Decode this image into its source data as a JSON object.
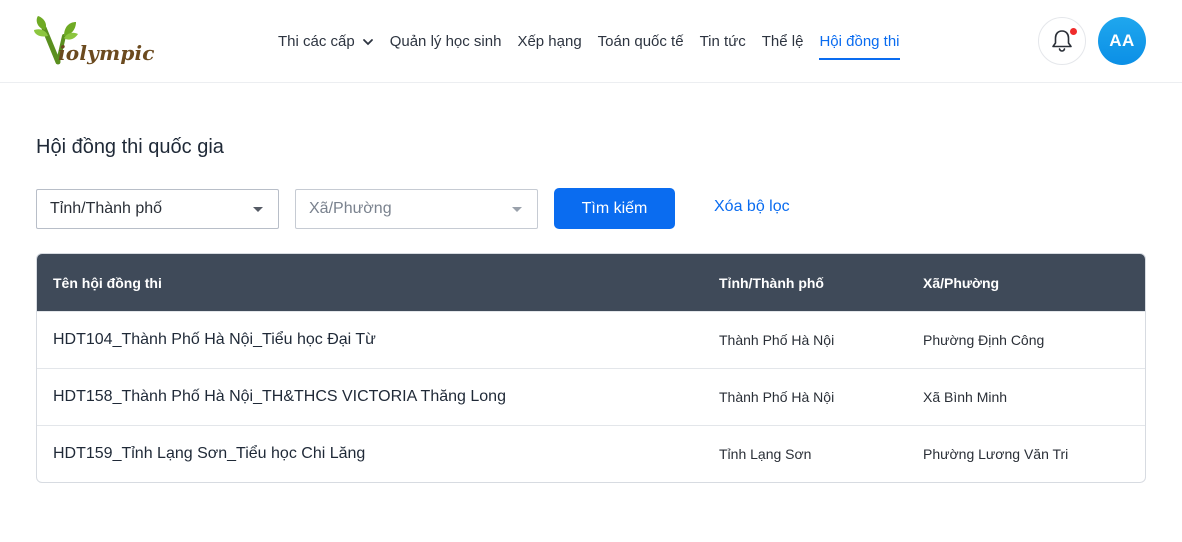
{
  "header": {
    "logo_text": "iolympic",
    "nav": [
      {
        "label": "Thi các cấp",
        "has_dropdown": true,
        "active": false
      },
      {
        "label": "Quản lý học sinh",
        "active": false
      },
      {
        "label": "Xếp hạng",
        "active": false
      },
      {
        "label": "Toán quốc tế",
        "active": false
      },
      {
        "label": "Tin tức",
        "active": false
      },
      {
        "label": "Thể lệ",
        "active": false
      },
      {
        "label": "Hội đồng thi",
        "active": true
      }
    ],
    "notification_icon": "bell-icon",
    "has_unread_notification": true,
    "avatar_initials": "AA"
  },
  "page": {
    "title": "Hội đồng thi quốc gia"
  },
  "filters": {
    "province_value": "Tỉnh/Thành phố",
    "ward_placeholder": "Xã/Phường",
    "search_label": "Tìm kiếm",
    "clear_label": "Xóa bộ lọc"
  },
  "table": {
    "headers": [
      "Tên hội đồng thi",
      "Tỉnh/Thành phố",
      "Xã/Phường"
    ],
    "rows": [
      [
        "HDT104_Thành Phố Hà Nội_Tiểu học Đại Từ",
        "Thành Phố Hà Nội",
        "Phường Định Công"
      ],
      [
        "HDT158_Thành Phố Hà Nội_TH&THCS VICTORIA Thăng Long",
        "Thành Phố Hà Nội",
        "Xã Bình Minh"
      ],
      [
        "HDT159_Tỉnh Lạng Sơn_Tiểu học Chi Lăng",
        "Tỉnh Lạng Sơn",
        "Phường Lương Văn Tri"
      ]
    ]
  },
  "colors": {
    "accent": "#0a6cf0",
    "table_header_bg": "#3f4a59",
    "avatar_bg": "#1a9fec",
    "notification_dot": "#ef2b2b"
  }
}
